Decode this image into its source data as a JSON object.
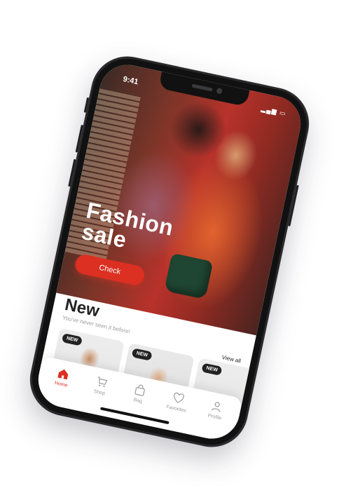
{
  "status": {
    "time": "9:41"
  },
  "hero": {
    "title_line1": "Fashion",
    "title_line2": "sale",
    "button_label": "Check"
  },
  "section": {
    "title": "New",
    "subtitle": "You've never seen it before!",
    "view_all": "View all"
  },
  "cards": [
    {
      "badge": "NEW"
    },
    {
      "badge": "NEW"
    },
    {
      "badge": "NEW"
    }
  ],
  "tabs": [
    {
      "label": "Home",
      "icon": "home-icon",
      "active": true
    },
    {
      "label": "Shop",
      "icon": "cart-icon",
      "active": false
    },
    {
      "label": "Bag",
      "icon": "bag-icon",
      "active": false
    },
    {
      "label": "Favorites",
      "icon": "heart-icon",
      "active": false
    },
    {
      "label": "Profile",
      "icon": "profile-icon",
      "active": false
    }
  ],
  "colors": {
    "accent": "#db3022",
    "text": "#222222",
    "muted": "#9b9b9b"
  }
}
